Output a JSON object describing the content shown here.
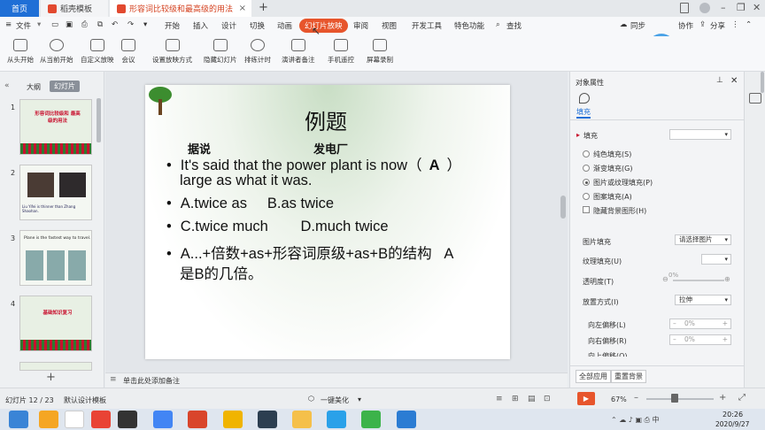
{
  "titlebar": {
    "tabs": [
      {
        "label": "首页"
      },
      {
        "label": "稻壳模板"
      },
      {
        "label": "形容词比较级和最高级的用法"
      }
    ],
    "new_tab": "+",
    "badge": "3"
  },
  "menubar": {
    "file": "文件",
    "items": [
      "开始",
      "插入",
      "设计",
      "切换",
      "动画",
      "幻灯片放映",
      "审阅",
      "视图",
      "开发工具",
      "特色功能"
    ],
    "search": "查找",
    "sync": "同步",
    "collab": "协作",
    "share": "分享"
  },
  "toolbar": {
    "buttons": [
      "从头开始",
      "从当前开始",
      "自定义放映",
      "会议",
      "设置放映方式",
      "隐藏幻灯片",
      "排练计时",
      "演讲者备注",
      "手机遥控",
      "屏幕录制"
    ]
  },
  "leftpanel": {
    "tabs": [
      "大纲",
      "幻灯片"
    ],
    "thumbs": [
      {
        "num": "1",
        "title": "形容词比较级和 最高级的用法"
      },
      {
        "num": "2",
        "title": "Liu Yifei is thinner than Zhang Shaohan."
      },
      {
        "num": "3",
        "title": "Plane is the fastest way to travel."
      },
      {
        "num": "4",
        "title": "基础知识复习"
      },
      {
        "num": "5",
        "title": ""
      }
    ],
    "add": "+"
  },
  "slide": {
    "title": "例题",
    "note_left": "据说",
    "note_right": "发电厂",
    "bullets": [
      {
        "text": "It's said that the power plant is now（",
        "answer": "A",
        "tail": "）"
      },
      {
        "text": "large as what it was."
      },
      {
        "text": "A.twice as     B.as twice"
      },
      {
        "text": "C.twice much        D.much twice"
      },
      {
        "text": "A...+倍数+as+形容词原级+as+B的结构   A"
      },
      {
        "text": "是B的几倍。"
      }
    ]
  },
  "notes": {
    "placeholder": "单击此处添加备注"
  },
  "rightpanel": {
    "title": "对象属性",
    "tab": "填充",
    "section": "填充",
    "options": [
      {
        "label": "纯色填充(S)",
        "checked": false
      },
      {
        "label": "渐变填充(G)",
        "checked": false
      },
      {
        "label": "图片或纹理填充(P)",
        "checked": true
      },
      {
        "label": "图案填充(A)",
        "checked": false
      }
    ],
    "hide_bg": "隐藏背景图形(H)",
    "image_fill_label": "图片填充",
    "image_fill_value": "请选择图片",
    "texture_label": "纹理填充(U)",
    "transparency_label": "透明度(T)",
    "transparency_value": "0%",
    "placement_label": "放置方式(I)",
    "placement_value": "拉伸",
    "offset_left_label": "向左偏移(L)",
    "offset_left_value": "0%",
    "offset_right_label": "向右偏移(R)",
    "offset_right_value": "0%",
    "offset_up_label": "向上偏移(O)",
    "apply_all": "全部应用",
    "reset_bg": "重置背景"
  },
  "statusbar": {
    "slide_info": "幻灯片 12 / 23",
    "template": "默认设计模板",
    "beautify": "一键美化",
    "zoom": "67%"
  },
  "taskbar": {
    "time": "20:26",
    "date": "2020/9/27"
  },
  "colors": {
    "accent": "#1f6fd6",
    "active_menu": "#e7552c",
    "thumb_title": "#c8102e"
  }
}
